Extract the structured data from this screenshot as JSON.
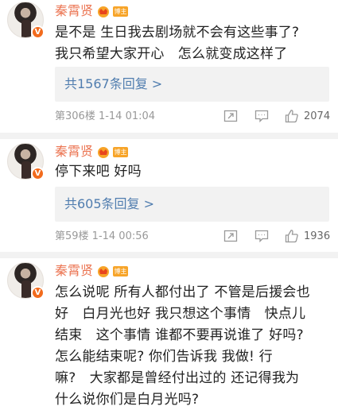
{
  "comments": [
    {
      "name": "秦霄贤",
      "vip_badge": "V",
      "tag": "博主",
      "lines": [
        "是不是 生日我去剧场就不会有这些事了?",
        "我只希望大家开心　怎么就变成这样了"
      ],
      "reply_link": "共1567条回复 >",
      "meta": "第306楼 1-14 01:04",
      "likes": "2074"
    },
    {
      "name": "秦霄贤",
      "vip_badge": "V",
      "tag": "博主",
      "lines": [
        "停下来吧 好吗"
      ],
      "reply_link": "共605条回复 >",
      "meta": "第59楼 1-14 00:56",
      "likes": "1936"
    },
    {
      "name": "秦霄贤",
      "vip_badge": "V",
      "tag": "博主",
      "lines": [
        "怎么说呢 所有人都付出了 不管是后援会也",
        "好　白月光也好 我只想这个事情　快点儿",
        "结束　这个事情 谁都不要再说谁了 好吗?",
        "怎么能结束呢? 你们告诉我 我做! 行",
        "嘛?　大家都是曾经付出过的 还记得我为",
        "什么说你们是白月光吗?"
      ]
    }
  ],
  "icons": [
    "repost-icon",
    "comment-icon",
    "like-icon",
    "crown-icon"
  ],
  "colors": {
    "name": "#eb7350",
    "link": "#507daf",
    "badge": "#f26b1d",
    "tag": "#f7a428"
  }
}
